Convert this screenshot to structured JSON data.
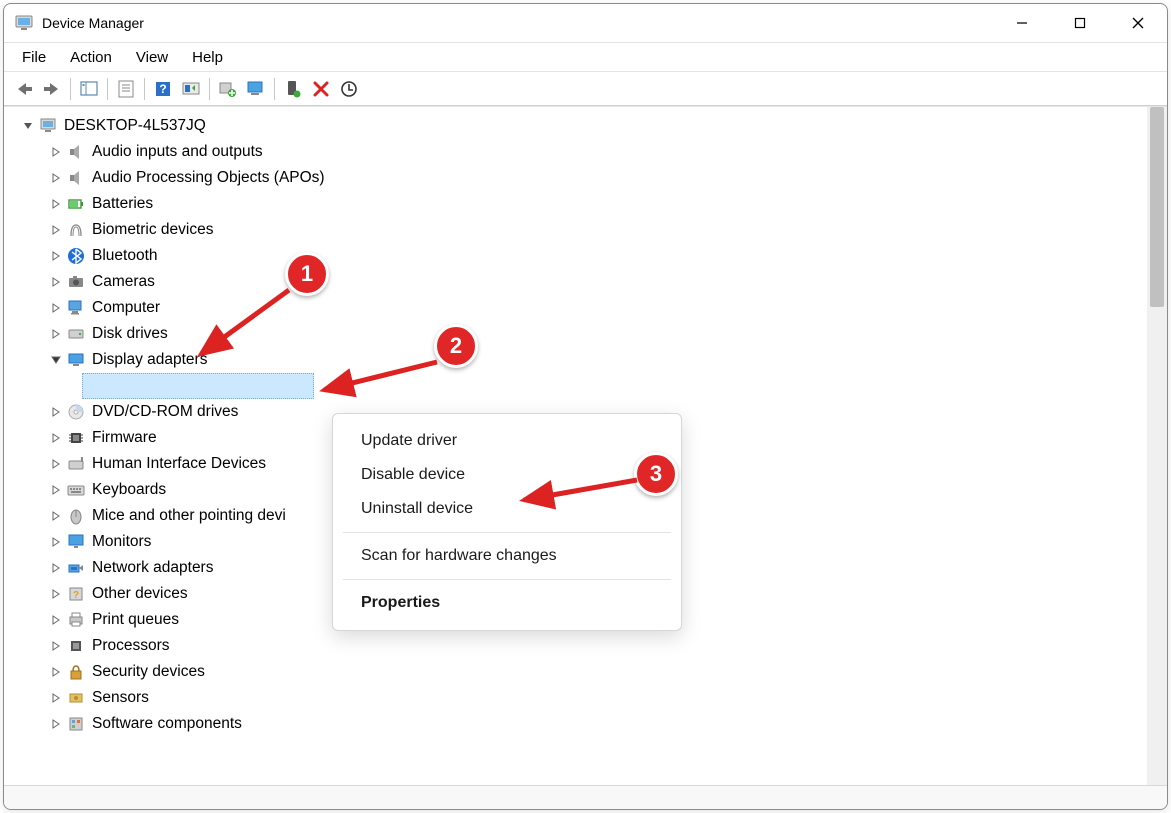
{
  "window": {
    "title": "Device Manager"
  },
  "menubar": [
    "File",
    "Action",
    "View",
    "Help"
  ],
  "tree": {
    "root": "DESKTOP-4L537JQ",
    "categories": [
      {
        "label": "Audio inputs and outputs",
        "expanded": false,
        "icon": "speaker"
      },
      {
        "label": "Audio Processing Objects (APOs)",
        "expanded": false,
        "icon": "speaker"
      },
      {
        "label": "Batteries",
        "expanded": false,
        "icon": "battery"
      },
      {
        "label": "Biometric devices",
        "expanded": false,
        "icon": "finger"
      },
      {
        "label": "Bluetooth",
        "expanded": false,
        "icon": "bluetooth"
      },
      {
        "label": "Cameras",
        "expanded": false,
        "icon": "camera"
      },
      {
        "label": "Computer",
        "expanded": false,
        "icon": "pc"
      },
      {
        "label": "Disk drives",
        "expanded": false,
        "icon": "disk"
      },
      {
        "label": "Display adapters",
        "expanded": true,
        "icon": "display"
      },
      {
        "label": "DVD/CD-ROM drives",
        "expanded": false,
        "icon": "cd"
      },
      {
        "label": "Firmware",
        "expanded": false,
        "icon": "chip"
      },
      {
        "label": "Human Interface Devices",
        "expanded": false,
        "icon": "hid"
      },
      {
        "label": "Keyboards",
        "expanded": false,
        "icon": "keyboard"
      },
      {
        "label": "Mice and other pointing devices",
        "expanded": false,
        "icon": "mouse",
        "clipped": "Mice and other pointing devi"
      },
      {
        "label": "Monitors",
        "expanded": false,
        "icon": "monitor"
      },
      {
        "label": "Network adapters",
        "expanded": false,
        "icon": "network"
      },
      {
        "label": "Other devices",
        "expanded": false,
        "icon": "other"
      },
      {
        "label": "Print queues",
        "expanded": false,
        "icon": "printer"
      },
      {
        "label": "Processors",
        "expanded": false,
        "icon": "cpu"
      },
      {
        "label": "Security devices",
        "expanded": false,
        "icon": "lock"
      },
      {
        "label": "Sensors",
        "expanded": false,
        "icon": "sensor"
      },
      {
        "label": "Software components",
        "expanded": false,
        "icon": "software"
      }
    ]
  },
  "context_menu": {
    "items": [
      {
        "label": "Update driver",
        "type": "item"
      },
      {
        "label": "Disable device",
        "type": "item"
      },
      {
        "label": "Uninstall device",
        "type": "item"
      },
      {
        "type": "sep"
      },
      {
        "label": "Scan for hardware changes",
        "type": "item"
      },
      {
        "type": "sep"
      },
      {
        "label": "Properties",
        "type": "item",
        "bold": true
      }
    ]
  },
  "annotations": {
    "badge1": "1",
    "badge2": "2",
    "badge3": "3"
  }
}
